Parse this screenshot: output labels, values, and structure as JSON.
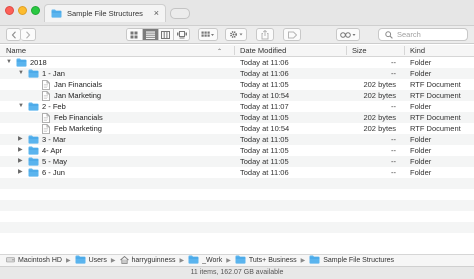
{
  "window": {
    "title": "Sample File Structures"
  },
  "toolbar": {
    "search_placeholder": "Search"
  },
  "columns": {
    "name": "Name",
    "date": "Date Modified",
    "size": "Size",
    "kind": "Kind"
  },
  "rows": [
    {
      "name": "2018",
      "date": "Today at 11:06",
      "size": "--",
      "kind": "Folder",
      "icon": "folder-icon",
      "level": 0,
      "disclosure": "expanded"
    },
    {
      "name": "1 - Jan",
      "date": "Today at 11:06",
      "size": "--",
      "kind": "Folder",
      "icon": "folder-icon",
      "level": 1,
      "disclosure": "expanded"
    },
    {
      "name": "Jan Financials",
      "date": "Today at 11:05",
      "size": "202 bytes",
      "kind": "RTF Document",
      "icon": "document-icon",
      "level": 2,
      "disclosure": "none"
    },
    {
      "name": "Jan Marketing",
      "date": "Today at 10:54",
      "size": "202 bytes",
      "kind": "RTF Document",
      "icon": "document-icon",
      "level": 2,
      "disclosure": "none"
    },
    {
      "name": "2 - Feb",
      "date": "Today at 11:07",
      "size": "--",
      "kind": "Folder",
      "icon": "folder-icon",
      "level": 1,
      "disclosure": "expanded"
    },
    {
      "name": "Feb Financials",
      "date": "Today at 11:05",
      "size": "202 bytes",
      "kind": "RTF Document",
      "icon": "document-icon",
      "level": 2,
      "disclosure": "none"
    },
    {
      "name": "Feb Marketing",
      "date": "Today at 10:54",
      "size": "202 bytes",
      "kind": "RTF Document",
      "icon": "document-icon",
      "level": 2,
      "disclosure": "none"
    },
    {
      "name": "3 - Mar",
      "date": "Today at 11:05",
      "size": "--",
      "kind": "Folder",
      "icon": "folder-icon",
      "level": 1,
      "disclosure": "collapsed"
    },
    {
      "name": "4- Apr",
      "date": "Today at 11:05",
      "size": "--",
      "kind": "Folder",
      "icon": "folder-icon",
      "level": 1,
      "disclosure": "collapsed"
    },
    {
      "name": "5 - May",
      "date": "Today at 11:05",
      "size": "--",
      "kind": "Folder",
      "icon": "folder-icon",
      "level": 1,
      "disclosure": "collapsed"
    },
    {
      "name": "6 - Jun",
      "date": "Today at 11:06",
      "size": "--",
      "kind": "Folder",
      "icon": "folder-icon",
      "level": 1,
      "disclosure": "collapsed"
    }
  ],
  "pathbar": [
    {
      "label": "Macintosh HD",
      "icon": "hard-drive-icon"
    },
    {
      "label": "Users",
      "icon": "folder-icon"
    },
    {
      "label": "harryguinness",
      "icon": "home-icon"
    },
    {
      "label": "_Work",
      "icon": "folder-icon"
    },
    {
      "label": "Tuts+ Business",
      "icon": "folder-icon"
    },
    {
      "label": "Sample File Structures",
      "icon": "folder-icon"
    }
  ],
  "status": {
    "text": "11 items, 162.07 GB available"
  },
  "colors": {
    "folder": "#5ab4ee",
    "folder_dark": "#3b9ee2",
    "close": "#fc5f57",
    "minimize": "#fdbc2e",
    "zoom": "#29c841",
    "view_active": "#7c7c7c"
  }
}
